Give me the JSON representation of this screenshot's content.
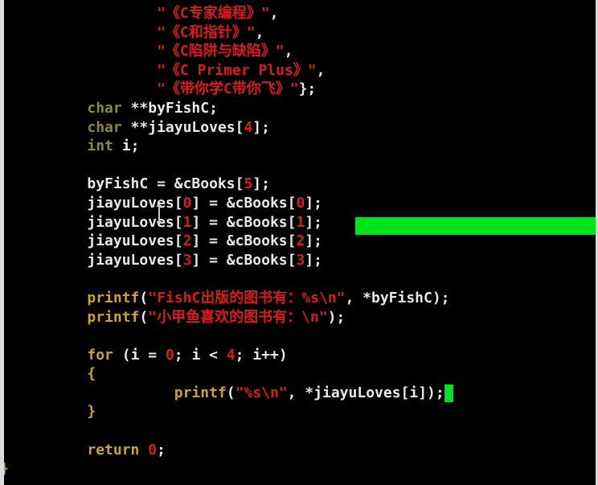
{
  "editor": {
    "lines": [
      {
        "indent": "                  ",
        "parts": [
          [
            "s",
            "\"《C专家编程》\""
          ],
          [
            "p",
            ","
          ]
        ]
      },
      {
        "indent": "                  ",
        "parts": [
          [
            "s",
            "\"《C和指针》\""
          ],
          [
            "p",
            ","
          ]
        ]
      },
      {
        "indent": "                  ",
        "parts": [
          [
            "s",
            "\"《C陷阱与缺陷》\""
          ],
          [
            "p",
            ","
          ]
        ]
      },
      {
        "indent": "                  ",
        "parts": [
          [
            "s",
            "\"《C Primer Plus》\""
          ],
          [
            "p",
            ","
          ]
        ]
      },
      {
        "indent": "                  ",
        "parts": [
          [
            "s",
            "\"《带你学C带你飞》\""
          ],
          [
            "p",
            "};"
          ]
        ]
      },
      {
        "indent": "          ",
        "parts": [
          [
            "t",
            "char"
          ],
          [
            "p",
            " **byFishC;"
          ]
        ]
      },
      {
        "indent": "          ",
        "parts": [
          [
            "t",
            "char"
          ],
          [
            "p",
            " **jiayuLoves["
          ],
          [
            "n",
            "4"
          ],
          [
            "p",
            "];"
          ]
        ]
      },
      {
        "indent": "          ",
        "parts": [
          [
            "t",
            "int"
          ],
          [
            "p",
            " i;"
          ]
        ]
      },
      {
        "indent": "",
        "parts": []
      },
      {
        "indent": "          ",
        "parts": [
          [
            "p",
            "byFishC = &cBooks["
          ],
          [
            "n",
            "5"
          ],
          [
            "p",
            "];"
          ]
        ]
      },
      {
        "indent": "          ",
        "parts": [
          [
            "p",
            "jiayuLoves["
          ],
          [
            "n",
            "0"
          ],
          [
            "p",
            "] = &cBooks["
          ],
          [
            "n",
            "0"
          ],
          [
            "p",
            "];"
          ]
        ]
      },
      {
        "indent": "          ",
        "parts": [
          [
            "p",
            "jiayuLoves["
          ],
          [
            "n",
            "1"
          ],
          [
            "p",
            "] = &cBooks["
          ],
          [
            "n",
            "1"
          ],
          [
            "p",
            "];"
          ]
        ]
      },
      {
        "indent": "          ",
        "parts": [
          [
            "p",
            "jiayuLoves["
          ],
          [
            "n",
            "2"
          ],
          [
            "p",
            "] = &cBooks["
          ],
          [
            "n",
            "2"
          ],
          [
            "p",
            "];"
          ]
        ]
      },
      {
        "indent": "          ",
        "parts": [
          [
            "p",
            "jiayuLoves["
          ],
          [
            "n",
            "3"
          ],
          [
            "p",
            "] = &cBooks["
          ],
          [
            "n",
            "3"
          ],
          [
            "p",
            "];"
          ]
        ]
      },
      {
        "indent": "",
        "parts": []
      },
      {
        "indent": "          ",
        "parts": [
          [
            "k",
            "printf"
          ],
          [
            "p",
            "("
          ],
          [
            "s",
            "\"FishC出版的图书有：%s\\n\""
          ],
          [
            "p",
            ", *byFishC);"
          ]
        ]
      },
      {
        "indent": "          ",
        "parts": [
          [
            "k",
            "printf"
          ],
          [
            "p",
            "("
          ],
          [
            "s",
            "\"小甲鱼喜欢的图书有：\\n\""
          ],
          [
            "p",
            ");"
          ]
        ]
      },
      {
        "indent": "",
        "parts": []
      },
      {
        "indent": "          ",
        "parts": [
          [
            "k",
            "for"
          ],
          [
            "p",
            " (i = "
          ],
          [
            "n",
            "0"
          ],
          [
            "p",
            "; i < "
          ],
          [
            "n",
            "4"
          ],
          [
            "p",
            "; i++)"
          ]
        ]
      },
      {
        "indent": "          ",
        "parts": [
          [
            "k",
            "{"
          ]
        ]
      },
      {
        "indent": "                    ",
        "parts": [
          [
            "k",
            "printf"
          ],
          [
            "p",
            "("
          ],
          [
            "s",
            "\"%s\\n\""
          ],
          [
            "p",
            ", *jiayuLoves[i]);"
          ]
        ],
        "cursor": true
      },
      {
        "indent": "          ",
        "parts": [
          [
            "k",
            "}"
          ]
        ]
      },
      {
        "indent": "",
        "parts": []
      },
      {
        "indent": "          ",
        "parts": [
          [
            "k",
            "return"
          ],
          [
            "p",
            " "
          ],
          [
            "n",
            "0"
          ],
          [
            "p",
            ";"
          ]
        ]
      },
      {
        "indent": "",
        "parts": [
          [
            "k",
            "}"
          ]
        ]
      }
    ]
  },
  "colors": {
    "background": "#000000",
    "string": "#d81b1b",
    "type": "#8a8a30",
    "keyword": "#c9a233",
    "cursor": "#00e21c"
  }
}
